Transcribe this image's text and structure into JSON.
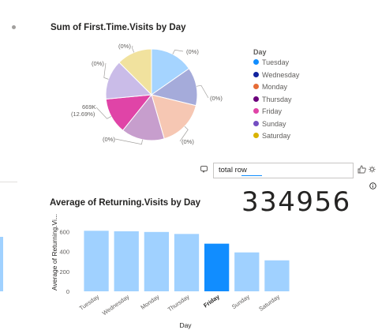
{
  "colors": {
    "tuesday": "#118dff",
    "wednesday": "#12239e",
    "monday": "#e66c37",
    "thursday": "#6b007b",
    "friday": "#e044a7",
    "sunday": "#744ec2",
    "saturday": "#d9b300",
    "bar_default": "#a0d1ff",
    "bar_selected": "#118dff"
  },
  "pie_chart": {
    "title": "Sum of First.Time.Visits by Day",
    "legend_title": "Day",
    "legend_items": [
      "Tuesday",
      "Wednesday",
      "Monday",
      "Thursday",
      "Friday",
      "Sunday",
      "Saturday"
    ],
    "labels": {
      "saturday": "(0%)",
      "tuesday": "(0%)",
      "wednesday": "(0%)",
      "monday": "(0%)",
      "friday_value": "669K",
      "friday_pct": "(12.69%)",
      "thursday": "(0%)",
      "sunday": "(0%)"
    }
  },
  "chart_data": [
    {
      "type": "pie",
      "title": "Sum of First.Time.Visits by Day",
      "legend_title": "Day",
      "series": [
        {
          "name": "Tuesday",
          "share": 0.153
        },
        {
          "name": "Wednesday",
          "share": 0.135
        },
        {
          "name": "Monday",
          "share": 0.167
        },
        {
          "name": "Thursday",
          "share": 0.153
        },
        {
          "name": "Friday",
          "share": 0.1269
        },
        {
          "name": "Sunday",
          "share": 0.14
        },
        {
          "name": "Saturday",
          "share": 0.125
        }
      ],
      "data_labels": [
        "(0%)",
        "(0%)",
        "(0%)",
        "(0%)",
        "669K (12.69%)",
        "(0%)",
        "(0%)"
      ],
      "legend_position": "right"
    },
    {
      "type": "bar",
      "title": "Average of Returning.Visits by Day",
      "categories": [
        "Tuesday",
        "Wednesday",
        "Monday",
        "Thursday",
        "Friday",
        "Sunday",
        "Saturday"
      ],
      "values": [
        610,
        605,
        598,
        578,
        480,
        392,
        312
      ],
      "highlighted": "Friday",
      "xlabel": "Day",
      "ylabel": "Average of Returning.Vi...",
      "ylim": [
        0,
        700
      ],
      "yticks": [
        0,
        200,
        400,
        600
      ],
      "grid": false
    }
  ],
  "qa": {
    "value": "total row"
  },
  "kpi": {
    "value": "334956"
  },
  "icons": {
    "chat": "chat-bubble-icon",
    "thumbs": "thumbs-icon",
    "settings": "gear-icon",
    "info": "info-icon"
  }
}
